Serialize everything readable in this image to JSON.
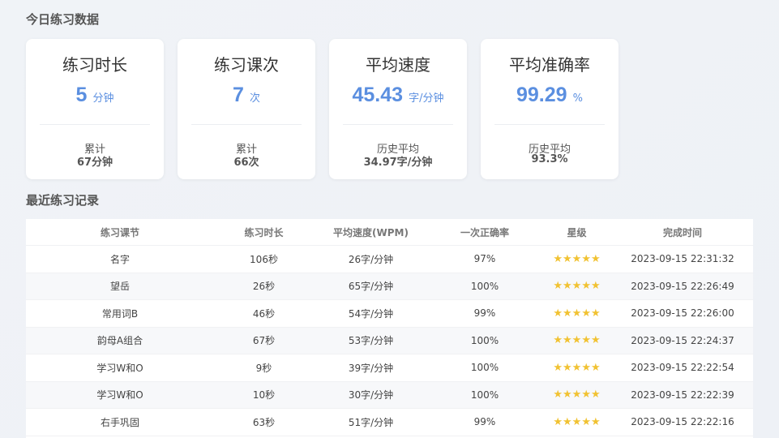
{
  "today_title": "今日练习数据",
  "recent_title": "最近练习记录",
  "cards": [
    {
      "title": "练习时长",
      "value": "5",
      "unit": "分钟",
      "sub_label": "累计",
      "sub_value": "67分钟"
    },
    {
      "title": "练习课次",
      "value": "7",
      "unit": "次",
      "sub_label": "累计",
      "sub_value": "66次"
    },
    {
      "title": "平均速度",
      "value": "45.43",
      "unit": "字/分钟",
      "sub_label": "历史平均",
      "sub_value": "34.97字/分钟"
    },
    {
      "title": "平均准确率",
      "value": "99.29",
      "unit": "%",
      "sub_label": "历史平均",
      "sub_value": "93.3%"
    }
  ],
  "table": {
    "headers": [
      "练习课节",
      "练习时长",
      "平均速度(WPM)",
      "一次正确率",
      "星级",
      "完成时间"
    ],
    "rows": [
      {
        "lesson": "名字",
        "duration": "106秒",
        "speed": "26字/分钟",
        "accuracy": "97%",
        "stars": 5,
        "stars_text": "★★★★★",
        "time": "2023-09-15 22:31:32"
      },
      {
        "lesson": "望岳",
        "duration": "26秒",
        "speed": "65字/分钟",
        "accuracy": "100%",
        "stars": 5,
        "stars_text": "★★★★★",
        "time": "2023-09-15 22:26:49"
      },
      {
        "lesson": "常用词B",
        "duration": "46秒",
        "speed": "54字/分钟",
        "accuracy": "99%",
        "stars": 5,
        "stars_text": "★★★★★",
        "time": "2023-09-15 22:26:00"
      },
      {
        "lesson": "韵母A组合",
        "duration": "67秒",
        "speed": "53字/分钟",
        "accuracy": "100%",
        "stars": 5,
        "stars_text": "★★★★★",
        "time": "2023-09-15 22:24:37"
      },
      {
        "lesson": "学习W和O",
        "duration": "9秒",
        "speed": "39字/分钟",
        "accuracy": "100%",
        "stars": 5,
        "stars_text": "★★★★★",
        "time": "2023-09-15 22:22:54"
      },
      {
        "lesson": "学习W和O",
        "duration": "10秒",
        "speed": "30字/分钟",
        "accuracy": "100%",
        "stars": 5,
        "stars_text": "★★★★★",
        "time": "2023-09-15 22:22:39"
      },
      {
        "lesson": "右手巩固",
        "duration": "63秒",
        "speed": "51字/分钟",
        "accuracy": "99%",
        "stars": 5,
        "stars_text": "★★★★★",
        "time": "2023-09-15 22:22:16"
      }
    ]
  },
  "colors": {
    "accent": "#5b8fe0",
    "star": "#f1c232"
  }
}
